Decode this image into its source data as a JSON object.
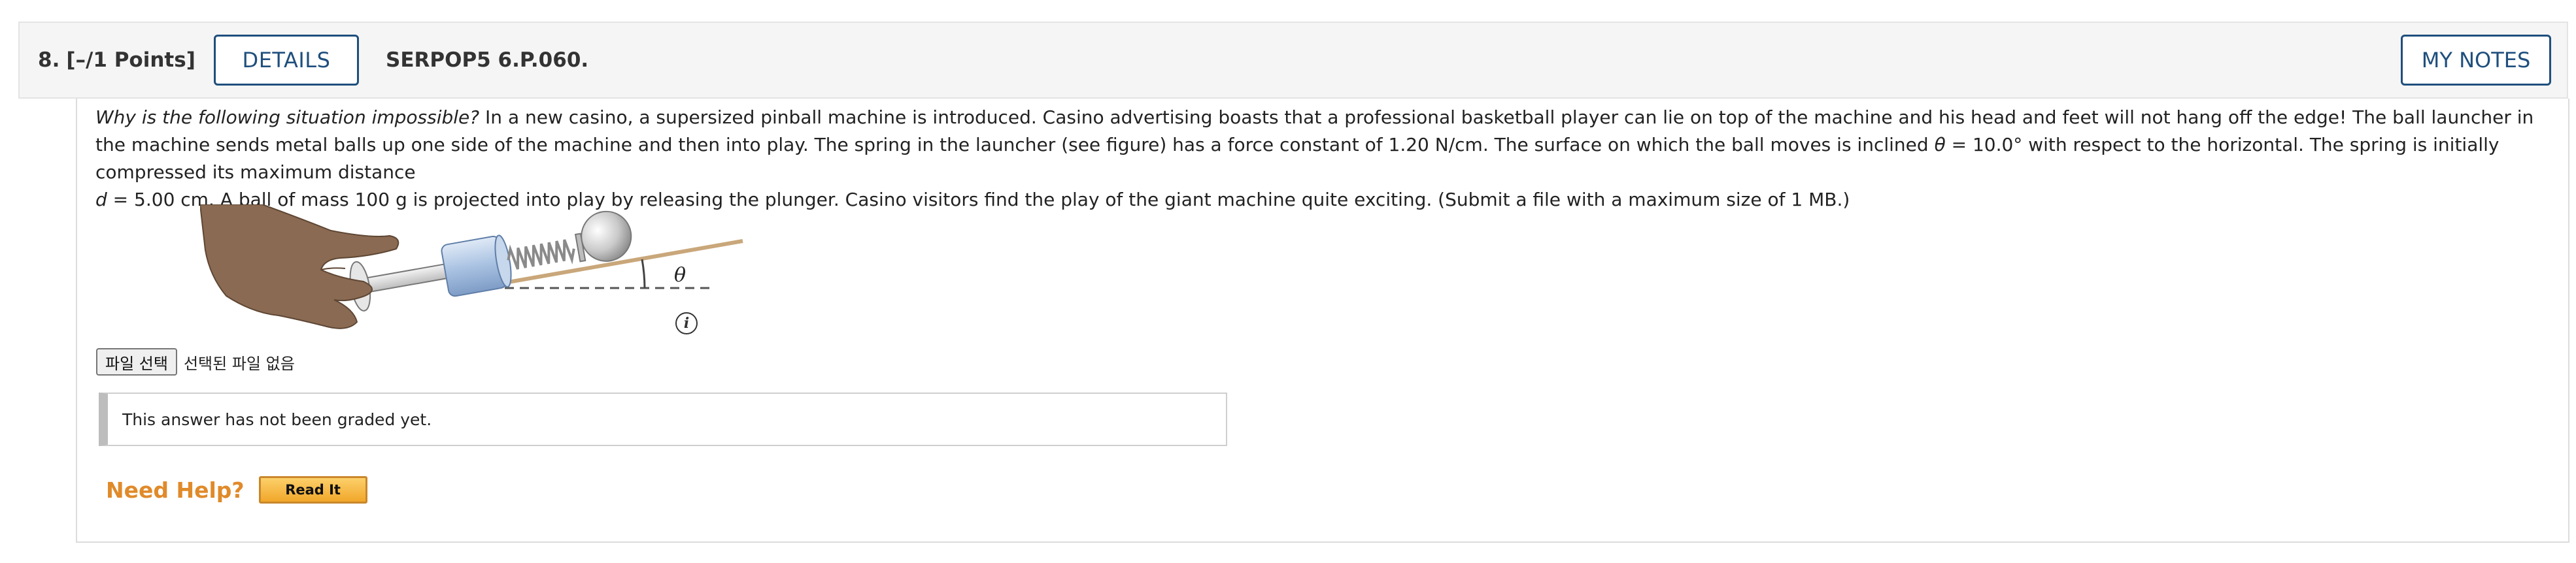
{
  "question": {
    "number": "8.",
    "points": "[–/1 Points]",
    "details_label": "DETAILS",
    "code": "SERPOP5 6.P.060.",
    "my_notes_label": "MY NOTES"
  },
  "problem": {
    "lead_italic": "Why is the following situation impossible?",
    "text_1": " In a new casino, a supersized pinball machine is introduced. Casino advertising boasts that a professional basketball player can lie on top of the machine and his head and feet will not hang off the edge! The ball launcher in the machine sends metal balls up one side of the machine and then into play. The spring in the launcher (see figure) has a force constant of 1.20 N/cm. The surface on which the ball moves is inclined ",
    "theta_symbol": "θ",
    "text_2": " = 10.0° with respect to the horizontal. The spring is initially compressed its maximum distance ",
    "d_symbol": "d",
    "text_3": " = 5.00 cm. A ball of mass 100 g is projected into play by releasing the plunger. Casino visitors find the play of the giant machine quite exciting. (Submit a file with a maximum size of 1 MB.)"
  },
  "figure": {
    "angle_label": "θ"
  },
  "file_input": {
    "button_label": "파일 선택",
    "status": "선택된 파일 없음"
  },
  "grade_message": "This answer has not been graded yet.",
  "help": {
    "need_help_label": "Need Help?",
    "read_it_label": "Read It"
  },
  "colors": {
    "button_border": "#1f4f7d",
    "need_help": "#e08a2a",
    "read_it_fill": "#f1a72a"
  },
  "icons": {
    "info": "info-icon"
  }
}
